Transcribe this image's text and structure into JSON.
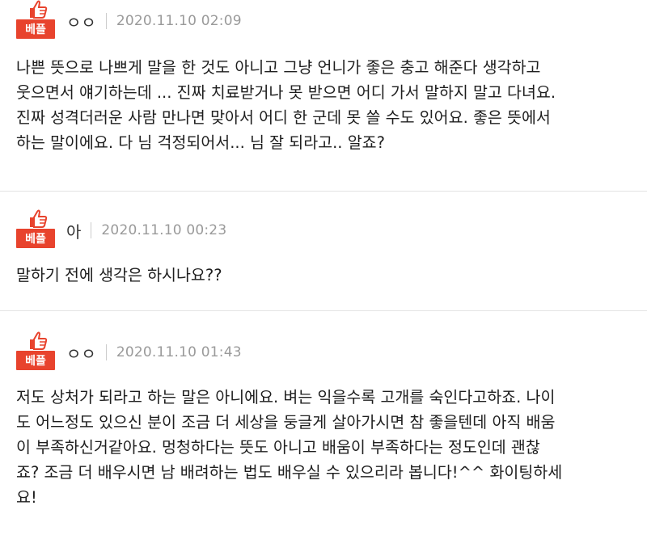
{
  "comments": [
    {
      "badge": "베플",
      "nickname": "ㅇㅇ",
      "date": "2020.11.10 02:09",
      "text": "나쁜 뜻으로 나쁘게 말을 한 것도 아니고 그냥 언니가 좋은 충고 해준다 생각하고\n웃으면서 얘기하는데 ... 진짜 치료받거나 못 받으면 어디 가서 말하지 말고 다녀요.\n진짜 성격더러운 사람 만나면 맞아서 어디 한 군데 못 쓸 수도 있어요. 좋은 뜻에서\n하는 말이에요. 다 님 걱정되어서... 님 잘 되라고.. 알죠?"
    },
    {
      "badge": "베플",
      "nickname": "아",
      "date": "2020.11.10 00:23",
      "text": "말하기 전에 생각은 하시나요??"
    },
    {
      "badge": "베플",
      "nickname": "ㅇㅇ",
      "date": "2020.11.10 01:43",
      "text": "저도 상처가 되라고 하는 말은 아니에요. 벼는 익을수록 고개를 숙인다고하죠. 나이\n도 어느정도 있으신 분이 조금 더 세상을 둥글게 살아가시면 참 좋을텐데 아직 배움\n이 부족하신거같아요. 멍청하다는 뜻도 아니고 배움이 부족하다는 정도인데 괜찮\n죠? 조금 더 배우시면 남 배려하는 법도 배우실 수 있으리라 봅니다!^^ 화이팅하세\n요!"
    }
  ]
}
